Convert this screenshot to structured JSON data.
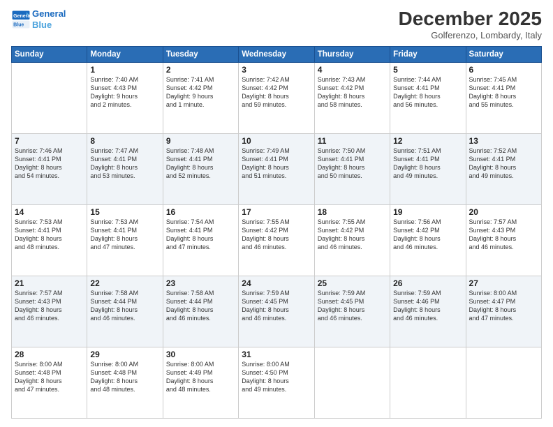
{
  "logo": {
    "line1": "General",
    "line2": "Blue"
  },
  "title": "December 2025",
  "location": "Golferenzo, Lombardy, Italy",
  "headers": [
    "Sunday",
    "Monday",
    "Tuesday",
    "Wednesday",
    "Thursday",
    "Friday",
    "Saturday"
  ],
  "weeks": [
    [
      {
        "day": "",
        "info": ""
      },
      {
        "day": "1",
        "info": "Sunrise: 7:40 AM\nSunset: 4:43 PM\nDaylight: 9 hours\nand 2 minutes."
      },
      {
        "day": "2",
        "info": "Sunrise: 7:41 AM\nSunset: 4:42 PM\nDaylight: 9 hours\nand 1 minute."
      },
      {
        "day": "3",
        "info": "Sunrise: 7:42 AM\nSunset: 4:42 PM\nDaylight: 8 hours\nand 59 minutes."
      },
      {
        "day": "4",
        "info": "Sunrise: 7:43 AM\nSunset: 4:42 PM\nDaylight: 8 hours\nand 58 minutes."
      },
      {
        "day": "5",
        "info": "Sunrise: 7:44 AM\nSunset: 4:41 PM\nDaylight: 8 hours\nand 56 minutes."
      },
      {
        "day": "6",
        "info": "Sunrise: 7:45 AM\nSunset: 4:41 PM\nDaylight: 8 hours\nand 55 minutes."
      }
    ],
    [
      {
        "day": "7",
        "info": "Sunrise: 7:46 AM\nSunset: 4:41 PM\nDaylight: 8 hours\nand 54 minutes."
      },
      {
        "day": "8",
        "info": "Sunrise: 7:47 AM\nSunset: 4:41 PM\nDaylight: 8 hours\nand 53 minutes."
      },
      {
        "day": "9",
        "info": "Sunrise: 7:48 AM\nSunset: 4:41 PM\nDaylight: 8 hours\nand 52 minutes."
      },
      {
        "day": "10",
        "info": "Sunrise: 7:49 AM\nSunset: 4:41 PM\nDaylight: 8 hours\nand 51 minutes."
      },
      {
        "day": "11",
        "info": "Sunrise: 7:50 AM\nSunset: 4:41 PM\nDaylight: 8 hours\nand 50 minutes."
      },
      {
        "day": "12",
        "info": "Sunrise: 7:51 AM\nSunset: 4:41 PM\nDaylight: 8 hours\nand 49 minutes."
      },
      {
        "day": "13",
        "info": "Sunrise: 7:52 AM\nSunset: 4:41 PM\nDaylight: 8 hours\nand 49 minutes."
      }
    ],
    [
      {
        "day": "14",
        "info": "Sunrise: 7:53 AM\nSunset: 4:41 PM\nDaylight: 8 hours\nand 48 minutes."
      },
      {
        "day": "15",
        "info": "Sunrise: 7:53 AM\nSunset: 4:41 PM\nDaylight: 8 hours\nand 47 minutes."
      },
      {
        "day": "16",
        "info": "Sunrise: 7:54 AM\nSunset: 4:41 PM\nDaylight: 8 hours\nand 47 minutes."
      },
      {
        "day": "17",
        "info": "Sunrise: 7:55 AM\nSunset: 4:42 PM\nDaylight: 8 hours\nand 46 minutes."
      },
      {
        "day": "18",
        "info": "Sunrise: 7:55 AM\nSunset: 4:42 PM\nDaylight: 8 hours\nand 46 minutes."
      },
      {
        "day": "19",
        "info": "Sunrise: 7:56 AM\nSunset: 4:42 PM\nDaylight: 8 hours\nand 46 minutes."
      },
      {
        "day": "20",
        "info": "Sunrise: 7:57 AM\nSunset: 4:43 PM\nDaylight: 8 hours\nand 46 minutes."
      }
    ],
    [
      {
        "day": "21",
        "info": "Sunrise: 7:57 AM\nSunset: 4:43 PM\nDaylight: 8 hours\nand 46 minutes."
      },
      {
        "day": "22",
        "info": "Sunrise: 7:58 AM\nSunset: 4:44 PM\nDaylight: 8 hours\nand 46 minutes."
      },
      {
        "day": "23",
        "info": "Sunrise: 7:58 AM\nSunset: 4:44 PM\nDaylight: 8 hours\nand 46 minutes."
      },
      {
        "day": "24",
        "info": "Sunrise: 7:59 AM\nSunset: 4:45 PM\nDaylight: 8 hours\nand 46 minutes."
      },
      {
        "day": "25",
        "info": "Sunrise: 7:59 AM\nSunset: 4:45 PM\nDaylight: 8 hours\nand 46 minutes."
      },
      {
        "day": "26",
        "info": "Sunrise: 7:59 AM\nSunset: 4:46 PM\nDaylight: 8 hours\nand 46 minutes."
      },
      {
        "day": "27",
        "info": "Sunrise: 8:00 AM\nSunset: 4:47 PM\nDaylight: 8 hours\nand 47 minutes."
      }
    ],
    [
      {
        "day": "28",
        "info": "Sunrise: 8:00 AM\nSunset: 4:48 PM\nDaylight: 8 hours\nand 47 minutes."
      },
      {
        "day": "29",
        "info": "Sunrise: 8:00 AM\nSunset: 4:48 PM\nDaylight: 8 hours\nand 48 minutes."
      },
      {
        "day": "30",
        "info": "Sunrise: 8:00 AM\nSunset: 4:49 PM\nDaylight: 8 hours\nand 48 minutes."
      },
      {
        "day": "31",
        "info": "Sunrise: 8:00 AM\nSunset: 4:50 PM\nDaylight: 8 hours\nand 49 minutes."
      },
      {
        "day": "",
        "info": ""
      },
      {
        "day": "",
        "info": ""
      },
      {
        "day": "",
        "info": ""
      }
    ]
  ]
}
